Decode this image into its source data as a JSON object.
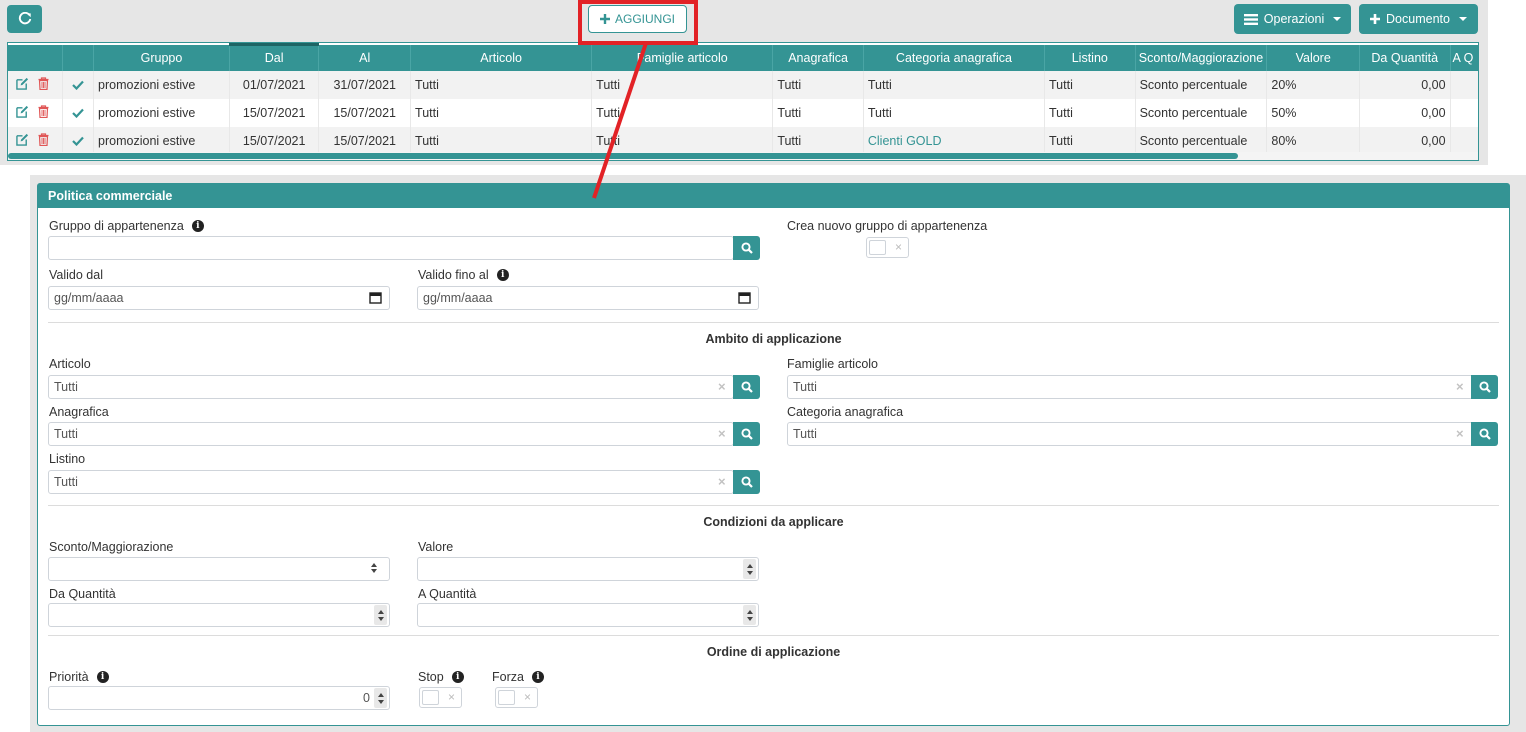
{
  "toolbar": {
    "add_label": "AGGIUNGI",
    "operations_label": "Operazioni",
    "document_label": "Documento"
  },
  "grid": {
    "columns": [
      "",
      "",
      "Gruppo",
      "Dal",
      "Al",
      "Articolo",
      "Famiglie articolo",
      "Anagrafica",
      "Categoria anagrafica",
      "Listino",
      "Sconto/Maggiorazione",
      "Valore",
      "Da Quantità",
      "A Q"
    ],
    "rows": [
      {
        "gruppo": "promozioni estive",
        "dal": "01/07/2021",
        "al": "31/07/2021",
        "articolo": "Tutti",
        "famiglie": "Tutti",
        "anagrafica": "Tutti",
        "categoria": "Tutti",
        "listino": "Tutti",
        "sconto": "Sconto percentuale",
        "valore": "20%",
        "da_quantita": "0,00"
      },
      {
        "gruppo": "promozioni estive",
        "dal": "15/07/2021",
        "al": "15/07/2021",
        "articolo": "Tutti",
        "famiglie": "Tutti",
        "anagrafica": "Tutti",
        "categoria": "Tutti",
        "listino": "Tutti",
        "sconto": "Sconto percentuale",
        "valore": "50%",
        "da_quantita": "0,00"
      },
      {
        "gruppo": "promozioni estive",
        "dal": "15/07/2021",
        "al": "15/07/2021",
        "articolo": "Tutti",
        "famiglie": "Tutti",
        "anagrafica": "Tutti",
        "categoria": "Clienti GOLD",
        "listino": "Tutti",
        "sconto": "Sconto percentuale",
        "valore": "80%",
        "da_quantita": "0,00"
      }
    ]
  },
  "form": {
    "title": "Politica commerciale",
    "gruppo_label": "Gruppo di appartenenza",
    "gruppo_value": "",
    "crea_gruppo_label": "Crea nuovo gruppo di appartenenza",
    "valido_dal_label": "Valido dal",
    "valido_dal_placeholder": "gg/mm/aaaa",
    "valido_al_label": "Valido fino al",
    "valido_al_placeholder": "gg/mm/aaaa",
    "ambito_title": "Ambito di applicazione",
    "articolo_label": "Articolo",
    "articolo_value": "Tutti",
    "famiglie_label": "Famiglie articolo",
    "famiglie_value": "Tutti",
    "anagrafica_label": "Anagrafica",
    "anagrafica_value": "Tutti",
    "categoria_label": "Categoria anagrafica",
    "categoria_value": "Tutti",
    "listino_label": "Listino",
    "listino_value": "Tutti",
    "condizioni_title": "Condizioni da applicare",
    "sconto_label": "Sconto/Maggiorazione",
    "valore_label": "Valore",
    "da_quantita_label": "Da Quantità",
    "a_quantita_label": "A Quantità",
    "ordine_title": "Ordine di applicazione",
    "priorita_label": "Priorità",
    "priorita_value": "0",
    "stop_label": "Stop",
    "forza_label": "Forza",
    "toggle_off_symbol": "×",
    "clear_symbol": "×"
  },
  "colors": {
    "accent": "#349494",
    "highlight": "#e22226",
    "panel_bg": "#e6e6e6"
  }
}
